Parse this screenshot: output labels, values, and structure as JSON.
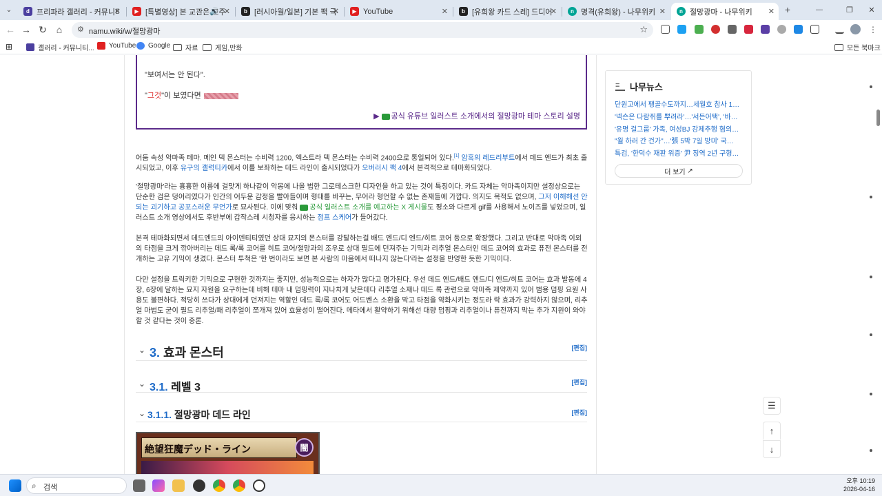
{
  "tabs": [
    {
      "title": "프리파라 갤러리 - 커뮤니티 포",
      "fav": "#4b3f9f",
      "favtxt": "d"
    },
    {
      "title": "[특별영상] 본 교관은 교주",
      "fav": "#e02020",
      "favtxt": "▶"
    },
    {
      "title": "[러시아월/일본] 기본 팩 극광의",
      "fav": "#222",
      "favtxt": "b"
    },
    {
      "title": "YouTube",
      "fav": "#e02020",
      "favtxt": "▶"
    },
    {
      "title": "[유희왕 카드 스레] 드디어 무",
      "fav": "#222",
      "favtxt": "b"
    },
    {
      "title": "명격(유희왕) - 나무위키",
      "fav": "#00a495",
      "favtxt": "n"
    },
    {
      "title": "절망광마 - 나무위키",
      "fav": "#00a495",
      "favtxt": "n"
    }
  ],
  "new_tab": "+",
  "window_controls": {
    "min": "—",
    "max": "❐",
    "close": "✕"
  },
  "address": {
    "url": "namu.wiki/w/절망광마"
  },
  "bookmarks": [
    {
      "label": "갤러리 - 커뮤니티...",
      "color": "#4b3f9f"
    },
    {
      "label": "YouTube",
      "color": "#e02020"
    },
    {
      "label": "Google",
      "color": "#4285f4"
    },
    {
      "label": "자료",
      "folder": true
    },
    {
      "label": "게임,만화",
      "folder": true
    }
  ],
  "all_bookmarks": "모든 북마크",
  "quote": {
    "line1": "\"보여서는 안 된다\".",
    "line2a": "\"",
    "line2b": "그것",
    "line2c": "\"이 보였다면",
    "caption_prefix": "▶",
    "caption": "공식 유튜브 일러스트 소개에서의 절망광마 테마 스토리 설명"
  },
  "p1": {
    "a": "어둠 속성 악마족 테마. 메인 덱 몬스터는 수비력 1200, 엑스트라 덱 몬스터는 수비력 2400으로 통일되어 있다.",
    "sup": "[1]",
    "b": " 암흑의 레드리부트",
    "c": "에서 데드 엔드가 최초 출시되었고, 이후 ",
    "d": "유구의 갤럭티카",
    "e": "에서 이를 보좌하는 데드 라인이 출시되었다가 ",
    "f": "오버러시 팩 4",
    "g": "에서 본격적으로 테마화되었다."
  },
  "p2": {
    "a": "'절망광마'라는 흉흉한 이름에 걸맞게 하나같이 악몽에 나올 법한 그로테스크한 디자인을 하고 있는 것이 특징이다. 카드 자체는 악마족이지만 설정상으로는 단순한 검은 덩어리였다가 인간의 어두운 감정을 빨아들이며 형태를 바꾸는, 무어라 형언할 수 없는 존재들에 가깝다. 의지도 목적도 없으며, ",
    "b": "그저 이해해선 안 되는 괴기하고 공포스러운 무언가",
    "c": "로 묘사된다. 이에 맞춰 ",
    "d": "공식 일러스트 소개를 예고하는 X 게시물",
    "e": "도 평소와 다르게 gif를 사용해서 노이즈를 넣었으며, 일러스트 소개 영상에서도 후반부에 갑작스레 시청자를 응시하는 ",
    "f": "점프 스케어",
    "g": "가 들어갔다."
  },
  "p3": "본격 테마화되면서 데드엔드의 아이덴티티였던 상대 묘지의 몬스터를 강탈하는걸 배드 엔드/디 엔드/히트 코어 등으로 확장했다. 그리고 반대로 악마족 이외의 타점을 크게 깎아버리는 데드 록/록 코어를 히트 코어/절망과의 조우로 상대 필드에 던져주는 기믹과 리추얼 몬스터인 데드 코어의 효과로 퓨전 몬스터를 전개하는 고유 기믹이 생겼다. 몬스터 투척은 '한 번이라도 보면 본 사람의 마음에서 떠나지 않는다'라는 설정을 반영한 듯한 기믹이다.",
  "p4": "다만 설정을 트릭키한 기믹으로 구현한 것까지는 좋지만, 성능적으로는 하자가 많다고 평가된다. 우선 데드 엔드/배드 엔드/디 엔드/히트 코어는 효과 발동에 4장, 6장에 달하는 묘지 자원을 요구하는데 비해 테마 내 덤핑력이 지나치게 낮은데다 리추얼 소재나 데드 록 관련으로 악마족 제약까지 있어 범용 덤핑 요원 사용도 불편하다. 적당히 쓰다가 상대에게 던져지는 역할인 데드 록/록 코어도 어드벤스 소환을 막고 타점을 약화시키는 정도라 락 효과가 강력하지 않으며, 리추얼 마법도 굳이 필드 리추얼/패 리추얼이 쪼개져 있어 효율성이 떨어진다. 메타에서 활약하기 위해선 대량 덤핑과 리추얼이나 퓨전까지 막는 추가 지원이 와야 할 것 같다는 것이 중론.",
  "headings": [
    {
      "num": "3.",
      "title": "효과 몬스터",
      "edit": "[편집]"
    },
    {
      "num": "3.1.",
      "title": "레벨 3",
      "edit": "[편집]"
    },
    {
      "num": "3.1.1.",
      "title": "절망광마 데드 라인",
      "edit": "[편집]"
    }
  ],
  "card": {
    "name": "絶望狂魔デッド・ライン",
    "attr": "闇"
  },
  "news": {
    "title": "나무뉴스",
    "items": [
      "단원고에서 팽골수도까지…세월호 참사 1…",
      "'넥슨은 다람쥐를 뿌려라'…'서든어택', '바…",
      "'유명 걸그룹' 가족, 여성BJ 강제추행 혐의…",
      "\"월 하러 간 건가\"…'張 5박 7일 방미' 국…",
      "특검, '한덕수 재판 위증' 尹 징역 2년 구형…"
    ],
    "more": "더 보기"
  },
  "float_buttons": {
    "toc": "☰",
    "up": "↑",
    "down": "↓"
  },
  "taskbar": {
    "search_placeholder": "검색",
    "time": "오후 10:19",
    "date": "2026-04-16"
  }
}
